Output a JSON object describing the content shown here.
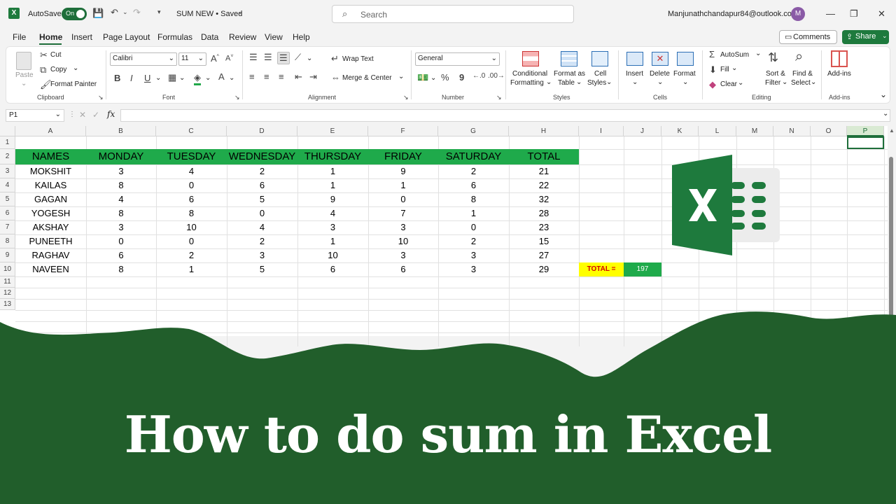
{
  "titlebar": {
    "autosave_label": "AutoSave",
    "autosave_state": "On",
    "file_title": "SUM NEW • Saved",
    "search_placeholder": "Search",
    "account": "Manjunathchandapur84@outlook.com",
    "avatar_initial": "M"
  },
  "menu": [
    "File",
    "Home",
    "Insert",
    "Page Layout",
    "Formulas",
    "Data",
    "Review",
    "View",
    "Help"
  ],
  "actions": {
    "comments": "Comments",
    "share": "Share"
  },
  "ribbon": {
    "clipboard": {
      "paste": "Paste",
      "cut": "Cut",
      "copy": "Copy",
      "format_painter": "Format Painter",
      "group": "Clipboard"
    },
    "font": {
      "name": "Calibri",
      "size": "11",
      "group": "Font",
      "bold": "B",
      "italic": "I",
      "underline": "U"
    },
    "alignment": {
      "wrap": "Wrap Text",
      "merge": "Merge & Center",
      "group": "Alignment"
    },
    "number": {
      "format": "General",
      "group": "Number",
      "percent": "%",
      "comma": "9"
    },
    "styles": {
      "conditional_1": "Conditional",
      "conditional_2": "Formatting",
      "format_as_1": "Format as",
      "format_as_2": "Table",
      "cell_styles_1": "Cell",
      "cell_styles_2": "Styles",
      "group": "Styles"
    },
    "cells": {
      "insert": "Insert",
      "delete": "Delete",
      "format": "Format",
      "group": "Cells"
    },
    "editing": {
      "autosum": "AutoSum",
      "fill": "Fill",
      "clear": "Clear",
      "sort_1": "Sort &",
      "sort_2": "Filter",
      "find_1": "Find &",
      "find_2": "Select",
      "group": "Editing"
    },
    "addins": {
      "label": "Add-ins",
      "group": "Add-ins"
    }
  },
  "formula_bar": {
    "name_box": "P1",
    "fx": "fx",
    "value": ""
  },
  "columns": [
    "A",
    "B",
    "C",
    "D",
    "E",
    "F",
    "G",
    "H",
    "I",
    "J",
    "K",
    "L",
    "M",
    "N",
    "O",
    "P"
  ],
  "rows": [
    "1",
    "2",
    "3",
    "4",
    "5",
    "6",
    "7",
    "8",
    "9",
    "10",
    "11",
    "12",
    "13"
  ],
  "table": {
    "headers": [
      "NAMES",
      "MONDAY",
      "TUESDAY",
      "WEDNESDAY",
      "THURSDAY",
      "FRIDAY",
      "SATURDAY",
      "TOTAL"
    ],
    "rows": [
      [
        "MOKSHIT",
        "3",
        "4",
        "2",
        "1",
        "9",
        "2",
        "21"
      ],
      [
        "KAILAS",
        "8",
        "0",
        "6",
        "1",
        "1",
        "6",
        "22"
      ],
      [
        "GAGAN",
        "4",
        "6",
        "5",
        "9",
        "0",
        "8",
        "32"
      ],
      [
        "YOGESH",
        "8",
        "8",
        "0",
        "4",
        "7",
        "1",
        "28"
      ],
      [
        "AKSHAY",
        "3",
        "10",
        "4",
        "3",
        "3",
        "0",
        "23"
      ],
      [
        "PUNEETH",
        "0",
        "0",
        "2",
        "1",
        "10",
        "2",
        "15"
      ],
      [
        "RAGHAV",
        "6",
        "2",
        "3",
        "10",
        "3",
        "3",
        "27"
      ],
      [
        "NAVEEN",
        "8",
        "1",
        "5",
        "6",
        "6",
        "3",
        "29"
      ]
    ],
    "total_label": "TOTAL =",
    "total_value": "197"
  },
  "overlay_title": "How to do sum in Excel",
  "colors": {
    "excel_green": "#1e7a3d",
    "banner_green": "#215e2b",
    "header_fill": "#1faa4b",
    "total_label_fill": "#ffff00",
    "total_value_fill": "#1faa4b"
  }
}
